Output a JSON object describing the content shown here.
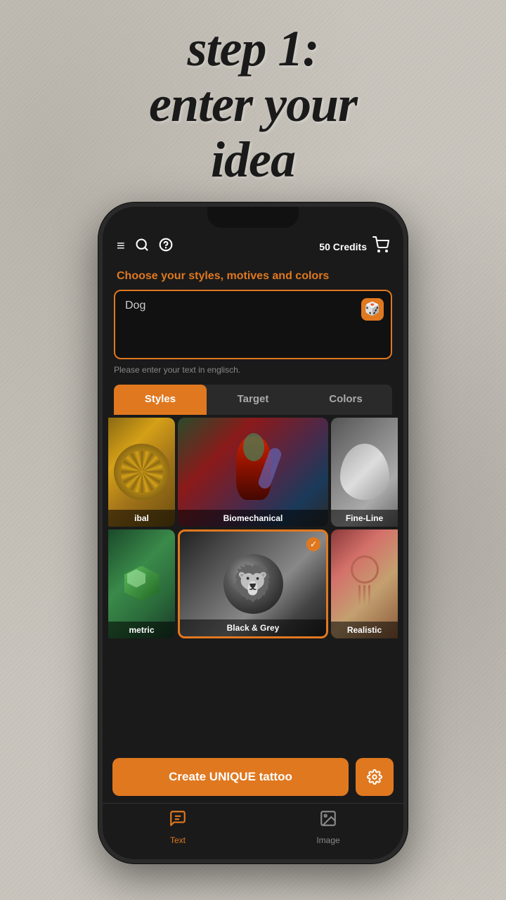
{
  "heading": {
    "line1": "step 1:",
    "line2": "enter your",
    "line3": "idea"
  },
  "header": {
    "credits": "50 Credits",
    "menu_icon": "≡",
    "search_icon": "🔍",
    "help_icon": "?"
  },
  "subtitle": "Choose your styles, motives and colors",
  "input": {
    "value": "Dog",
    "hint": "Please enter your text in englisch."
  },
  "tabs": [
    {
      "id": "styles",
      "label": "Styles",
      "active": true
    },
    {
      "id": "target",
      "label": "Target",
      "active": false
    },
    {
      "id": "colors",
      "label": "Colors",
      "active": false
    }
  ],
  "styles": [
    {
      "id": "tribal",
      "label": "ibal",
      "selected": false,
      "partial": true
    },
    {
      "id": "biomechanical",
      "label": "Biomechanical",
      "selected": false,
      "partial": false
    },
    {
      "id": "fineline",
      "label": "Fine-Line",
      "selected": false,
      "partial": true
    }
  ],
  "styles_row2": [
    {
      "id": "geometric",
      "label": "metric",
      "selected": false,
      "partial": true
    },
    {
      "id": "blackgrey",
      "label": "Black & Grey",
      "selected": true,
      "partial": false
    },
    {
      "id": "realistic",
      "label": "Realistic",
      "selected": false,
      "partial": true
    }
  ],
  "cta": {
    "create_label": "Create UNIQUE tattoo",
    "settings_icon": "⚙"
  },
  "bottom_nav": [
    {
      "id": "text",
      "label": "Text",
      "active": true,
      "icon": "💬"
    },
    {
      "id": "image",
      "label": "Image",
      "active": false,
      "icon": "🖼"
    }
  ]
}
